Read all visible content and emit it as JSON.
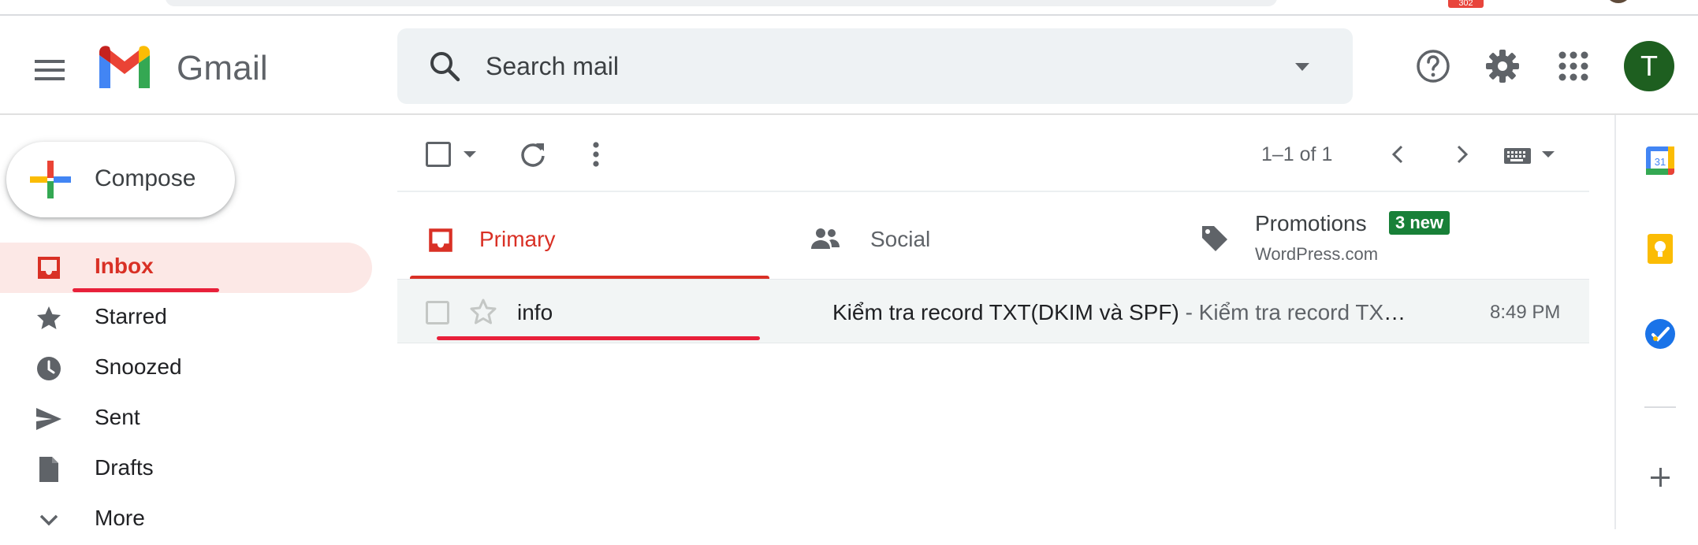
{
  "browser": {
    "extension_badge": "302"
  },
  "header": {
    "app_name": "Gmail",
    "search_placeholder": "Search mail",
    "avatar_letter": "T"
  },
  "compose": {
    "label": "Compose"
  },
  "nav": {
    "items": [
      {
        "label": "Inbox",
        "icon": "inbox-icon",
        "active": true
      },
      {
        "label": "Starred",
        "icon": "star-icon"
      },
      {
        "label": "Snoozed",
        "icon": "clock-icon"
      },
      {
        "label": "Sent",
        "icon": "send-icon"
      },
      {
        "label": "Drafts",
        "icon": "draft-icon"
      },
      {
        "label": "More",
        "icon": "chevron-down-icon"
      }
    ]
  },
  "toolbar": {
    "page_range": "1–1 of 1"
  },
  "tabs": [
    {
      "label": "Primary",
      "icon": "inbox-icon",
      "active": true
    },
    {
      "label": "Social",
      "icon": "people-icon"
    },
    {
      "label": "Promotions",
      "icon": "tag-icon",
      "badge": "3 new",
      "sub": "WordPress.com"
    }
  ],
  "emails": [
    {
      "sender": "info",
      "subject": "Kiểm tra record TXT(DKIM và SPF)",
      "snippet": " - Kiểm tra record TXT(DKIM và SPF) Kiểm tra record TXT",
      "time": "8:49 PM",
      "starred": false
    }
  ],
  "side_panel": {
    "calendar_day": "31",
    "apps": [
      "calendar-icon",
      "keep-icon",
      "tasks-icon",
      "add-icon"
    ]
  },
  "colors": {
    "accent_red": "#d93025",
    "annotation_red": "#e8203a",
    "badge_green": "#188038",
    "avatar_green": "#1e5f20"
  }
}
